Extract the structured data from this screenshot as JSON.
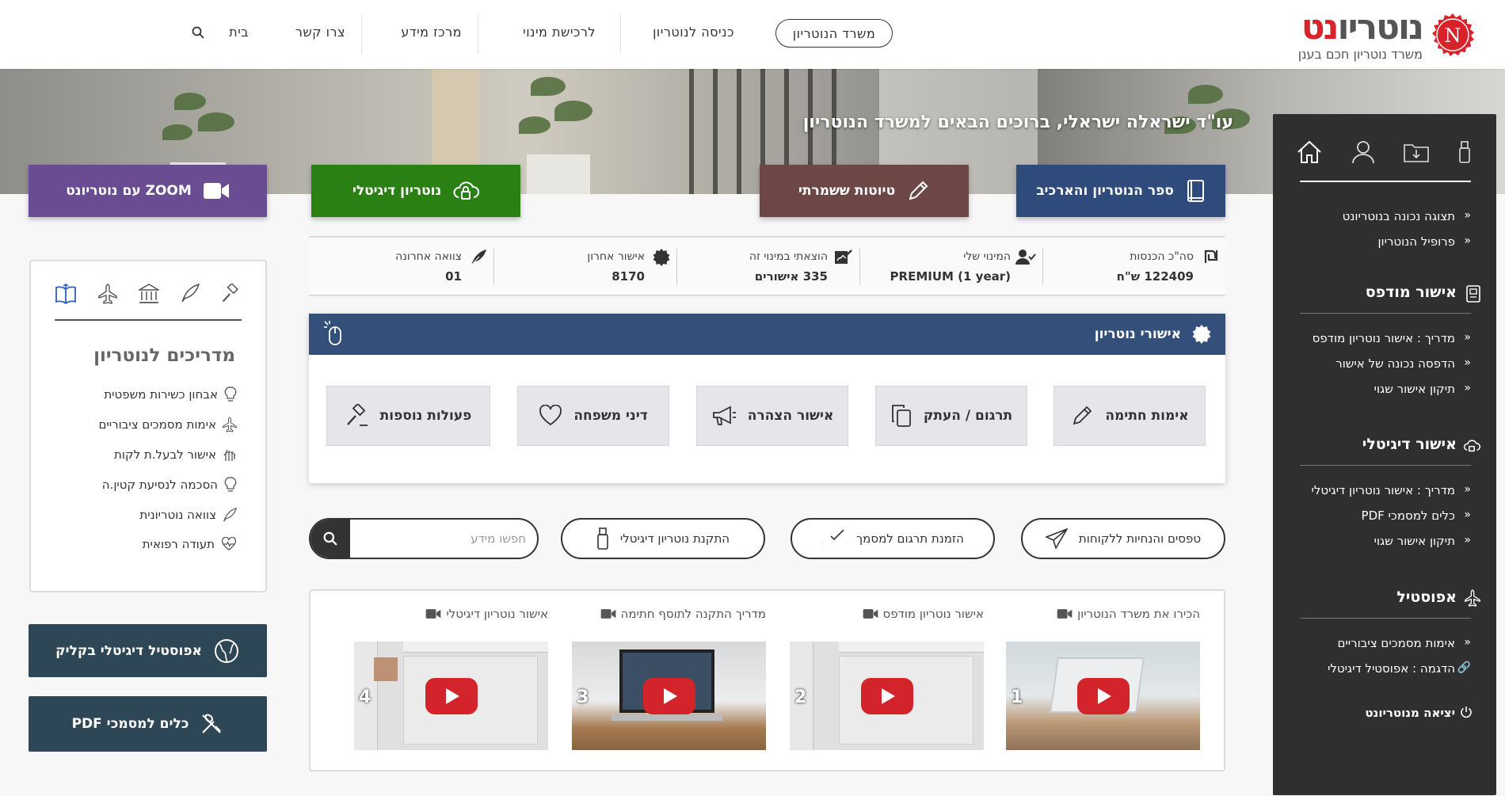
{
  "brand": {
    "logo_text_dark": "נוטריו",
    "logo_text_red": "נט",
    "logo_letter": "N",
    "tagline": "משרד נוטריון חכם בענן",
    "brand_color": "#d8232a"
  },
  "nav": {
    "office": "משרד הנוטריון",
    "enter": "כניסה לנוטריון",
    "buy_appointment": "לרכישת מינוי",
    "info_center": "מרכז מידע",
    "contact": "צרו קשר",
    "home": "בית",
    "search_icon": "search-icon"
  },
  "hero": {
    "title": "עו\"ד ישראלה ישראלי, ברוכים הבאים למשרד הנוטריון"
  },
  "big_buttons": {
    "book": "ספר הנוטריון והארכיב",
    "drafts": "טיוטות ששמרתי",
    "digital": "נוטריון דיגיטלי",
    "zoom": "ZOOM עם נוטריונט",
    "colors": {
      "book": "#2f4b7c",
      "drafts": "#6d4646",
      "digital": "#2a8012",
      "zoom": "#6a4c93"
    }
  },
  "stats": [
    {
      "label": "סה\"כ הכנסות",
      "value": "122409 ש\"ח",
      "icon": "shekel-icon"
    },
    {
      "label": "המינוי שלי",
      "value": "PREMIUM (1 year)",
      "icon": "user-check-icon"
    },
    {
      "label": "הוצאתי במינוי זה",
      "value": "335 אישורים",
      "icon": "signature-icon"
    },
    {
      "label": "אישור אחרון",
      "value": "8170",
      "icon": "seal-icon"
    },
    {
      "label": "צוואה אחרונה",
      "value": "01",
      "icon": "quill-icon"
    }
  ],
  "approvals": {
    "title": "אישורי נוטריון",
    "buttons": [
      "אימות חתימה",
      "תרגום / העתק",
      "אישור הצהרה",
      "דיני משפחה",
      "פעולות נוספות"
    ]
  },
  "pills": {
    "forms": "טפסים והנחיות ללקוחות",
    "translation": "הזמנת תרגום למסמך",
    "install": "התקנת נוטריון דיגיטלי",
    "search_placeholder": "חפשו מידע",
    "translation_icon_text": "abc"
  },
  "videos": [
    {
      "num": "1",
      "title": "הכירו את משרד הנוטריון"
    },
    {
      "num": "2",
      "title": "אישור נוטריון מודפס"
    },
    {
      "num": "3",
      "title": "מדריך התקנה לתוסף חתימה"
    },
    {
      "num": "4",
      "title": "אישור נוטריון דיגיטלי"
    }
  ],
  "sidebar": {
    "links_top": [
      "תצוגה נכונה בנוטריונט",
      "פרופיל הנוטריון"
    ],
    "printed": {
      "title": "אישור מודפס",
      "links": [
        "מדריך : אישור נוטריון מודפס",
        "הדפסה נכונה של אישור",
        "תיקון אישור שגוי"
      ]
    },
    "digital": {
      "title": "אישור דיגיטלי",
      "links": [
        "מדריך : אישור נוטריון דיגיטלי",
        "כלים למסמכי PDF",
        "תיקון אישור שגוי"
      ]
    },
    "apostille": {
      "title": "אפוסטיל",
      "links": [
        "אימות מסמכים ציבוריים",
        "הדגמה : אפוסטיל דיגיטלי"
      ]
    },
    "logout": "יציאה מנוטריונט",
    "chev": "«"
  },
  "guides": {
    "title": "מדריכים לנוטריון",
    "items": [
      "אבחון כשירות משפטית",
      "אימות מסמכים ציבוריים",
      "אישור לבעל.ת לקות",
      "הסכמה לנסיעת קטין.ה",
      "צוואה נוטריונית",
      "תעודה רפואית"
    ]
  },
  "left_buttons": {
    "apostille": "אפוסטיל דיגיטלי בקליק",
    "pdf_tools": "כלים למסמכי PDF"
  }
}
